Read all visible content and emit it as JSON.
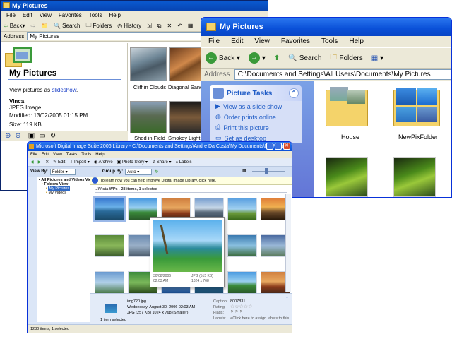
{
  "w1": {
    "title": "My Pictures",
    "menu": [
      "File",
      "Edit",
      "View",
      "Favorites",
      "Tools",
      "Help"
    ],
    "toolbar": {
      "back": "Back",
      "search": "Search",
      "folders": "Folders",
      "history": "History"
    },
    "address": {
      "label": "Address",
      "value": "My Pictures"
    },
    "panel": {
      "heading": "My Pictures",
      "view_prefix": "View pictures as",
      "view_link": "slideshow",
      "name": "Vinca",
      "type": "JPEG Image",
      "modified": "Modified: 13/02/2005 01:15 PM",
      "size": "Size: 119 KB"
    },
    "thumbs": [
      "Cliff in Clouds",
      "Diagonal Sand",
      "Shed in Field",
      "Smokey Light"
    ]
  },
  "w2": {
    "title": "My Pictures",
    "menu": [
      "File",
      "Edit",
      "View",
      "Favorites",
      "Tools",
      "Help"
    ],
    "toolbar": {
      "back": "Back",
      "search": "Search",
      "folders": "Folders"
    },
    "address": {
      "label": "Address",
      "value": "C:\\Documents and Settings\\All Users\\Documents\\My Pictures"
    },
    "tasks": {
      "heading": "Picture Tasks",
      "items": [
        "View as a slide show",
        "Order prints online",
        "Print this picture",
        "Set as desktop"
      ]
    },
    "folders": [
      "House",
      "NewPixFolder"
    ]
  },
  "w3": {
    "title": "Microsoft Digital Image Suite 2006 Library - C:\\Documents and Settings\\Andre Da Costa\\My Documents\\My Pictures",
    "menu": [
      "File",
      "Edit",
      "View",
      "Tasks",
      "Tools",
      "Help"
    ],
    "toolbar": [
      "Edit",
      "Import",
      "Archive",
      "Photo Story",
      "Share",
      "Labels"
    ],
    "view_by": {
      "label": "View By:",
      "value": "Folder"
    },
    "group_by": {
      "label": "Group By:",
      "value": "Auto"
    },
    "nav": {
      "root": "All Pictures and Videos View",
      "folders_view": "Folders View",
      "my_pictures": "My Pictures",
      "my_videos": "My Videos"
    },
    "infobar": "To learn how you can help improve Digital Image Library, click here.",
    "group_header": "...\\Vista WPs - 28 items, 1 selected",
    "preview": {
      "date": "30/08/2006",
      "time": "02:03 AM",
      "format": "JPG (515 KB)",
      "dims": "1024 x 768"
    },
    "details": {
      "filename": "img720.jpg",
      "date": "Wednesday, August 30, 2006 02:03 AM",
      "format": "JPG (257 KB) 1024 x 768 (Smaller)",
      "selected": "1 item selected",
      "caption_label": "Caption:",
      "caption_value": "8007831",
      "rating_label": "Rating:",
      "flags_label": "Flags:",
      "labels_label": "Labels:",
      "labels_value": "<Click here to assign labels to this..."
    },
    "status": "1230 items, 1 selected"
  }
}
